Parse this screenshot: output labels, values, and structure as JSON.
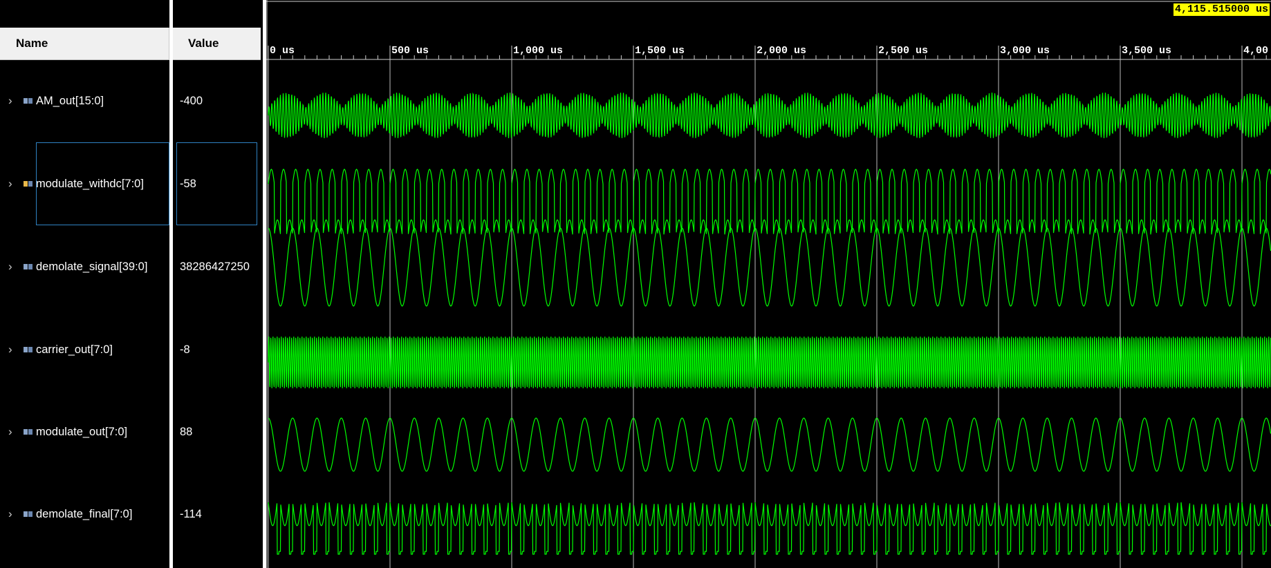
{
  "columns": {
    "name_header": "Name",
    "value_header": "Value"
  },
  "cursor": {
    "time_label": "4,115.515000 us",
    "time_us": 4115.515
  },
  "timeline": {
    "unit": "us",
    "range_us": [
      0,
      4115.515
    ],
    "major_ticks": [
      {
        "value": 0,
        "label": "0 us"
      },
      {
        "value": 500,
        "label": "500 us"
      },
      {
        "value": 1000,
        "label": "1,000 us"
      },
      {
        "value": 1500,
        "label": "1,500 us"
      },
      {
        "value": 2000,
        "label": "2,000 us"
      },
      {
        "value": 2500,
        "label": "2,500 us"
      },
      {
        "value": 3000,
        "label": "3,000 us"
      },
      {
        "value": 3500,
        "label": "3,500 us"
      },
      {
        "value": 4000,
        "label": "4,00"
      }
    ]
  },
  "signals": [
    {
      "name": "AM_out[15:0]",
      "value": "-400",
      "wave": "am",
      "icon": "bus-icon",
      "selected": false
    },
    {
      "name": "modulate_withdc[7:0]",
      "value": "-58",
      "wave": "rect",
      "icon": "bus-icon-active",
      "selected": true
    },
    {
      "name": "demolate_signal[39:0]",
      "value": "38286427250",
      "wave": "sine",
      "icon": "bus-icon",
      "selected": false
    },
    {
      "name": "carrier_out[7:0]",
      "value": "-8",
      "wave": "carrier",
      "icon": "bus-icon",
      "selected": false
    },
    {
      "name": "modulate_out[7:0]",
      "value": "88",
      "wave": "sine",
      "icon": "bus-icon",
      "selected": false
    },
    {
      "name": "demolate_final[7:0]",
      "value": "-114",
      "wave": "final",
      "icon": "bus-icon",
      "selected": false
    }
  ],
  "colors": {
    "wave": "#00ff00",
    "grid": "#d0d0d0",
    "cursor_bg": "#ffff00",
    "selection": "#2f83c4"
  }
}
